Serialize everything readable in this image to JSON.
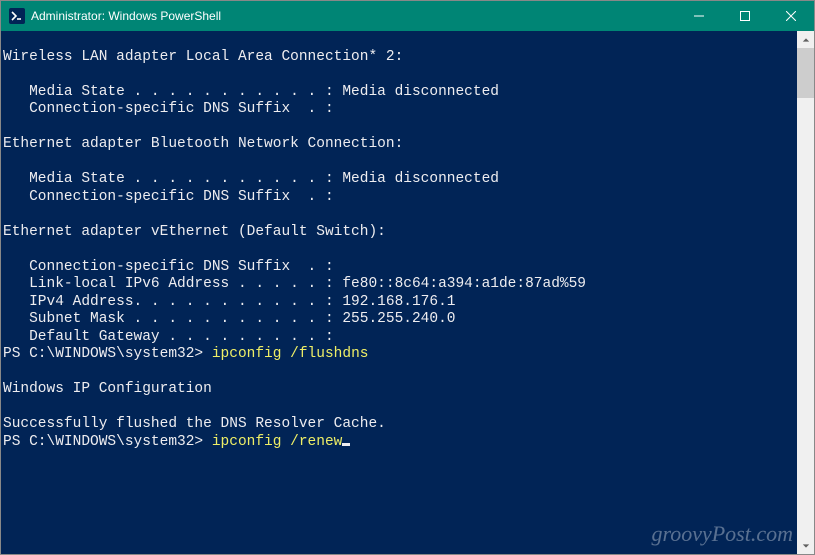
{
  "window": {
    "title": "Administrator: Windows PowerShell"
  },
  "terminal": {
    "lines": [
      {
        "text": ""
      },
      {
        "text": "Wireless LAN adapter Local Area Connection* 2:"
      },
      {
        "text": ""
      },
      {
        "text": "   Media State . . . . . . . . . . . : Media disconnected"
      },
      {
        "text": "   Connection-specific DNS Suffix  . :"
      },
      {
        "text": ""
      },
      {
        "text": "Ethernet adapter Bluetooth Network Connection:"
      },
      {
        "text": ""
      },
      {
        "text": "   Media State . . . . . . . . . . . : Media disconnected"
      },
      {
        "text": "   Connection-specific DNS Suffix  . :"
      },
      {
        "text": ""
      },
      {
        "text": "Ethernet adapter vEthernet (Default Switch):"
      },
      {
        "text": ""
      },
      {
        "text": "   Connection-specific DNS Suffix  . :"
      },
      {
        "text": "   Link-local IPv6 Address . . . . . : fe80::8c64:a394:a1de:87ad%59"
      },
      {
        "text": "   IPv4 Address. . . . . . . . . . . : 192.168.176.1"
      },
      {
        "text": "   Subnet Mask . . . . . . . . . . . : 255.255.240.0"
      },
      {
        "text": "   Default Gateway . . . . . . . . . :"
      },
      {
        "prompt": "PS C:\\WINDOWS\\system32> ",
        "cmd": "ipconfig /flushdns"
      },
      {
        "text": ""
      },
      {
        "text": "Windows IP Configuration"
      },
      {
        "text": ""
      },
      {
        "text": "Successfully flushed the DNS Resolver Cache."
      },
      {
        "prompt": "PS C:\\WINDOWS\\system32> ",
        "cmd": "ipconfig /renew",
        "cursor": true
      }
    ]
  },
  "watermark": "groovyPost.com"
}
